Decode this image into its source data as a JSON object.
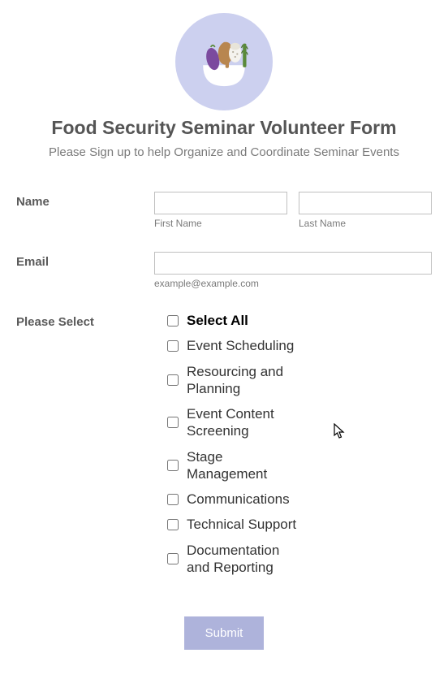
{
  "header": {
    "title": "Food Security Seminar Volunteer Form",
    "subtitle": "Please Sign up to help Organize and Coordinate Seminar Events"
  },
  "name": {
    "label": "Name",
    "first_name_sublabel": "First Name",
    "last_name_sublabel": "Last Name",
    "first_name_value": "",
    "last_name_value": ""
  },
  "email": {
    "label": "Email",
    "sublabel": "example@example.com",
    "value": ""
  },
  "select": {
    "label": "Please Select",
    "options": [
      {
        "label": "Select All",
        "bold": true
      },
      {
        "label": "Event Scheduling",
        "bold": false
      },
      {
        "label": "Resourcing and Planning",
        "bold": false
      },
      {
        "label": "Event Content Screening",
        "bold": false
      },
      {
        "label": "Stage Management",
        "bold": false
      },
      {
        "label": "Communications",
        "bold": false
      },
      {
        "label": "Technical Support",
        "bold": false
      },
      {
        "label": "Documentation and Reporting",
        "bold": false
      }
    ]
  },
  "submit": {
    "label": "Submit"
  },
  "icon": {
    "name": "food-bowl-icon"
  }
}
